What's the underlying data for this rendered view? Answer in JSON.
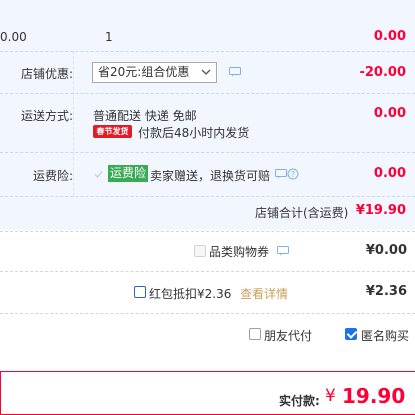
{
  "row_top": {
    "price": "0.00",
    "qty": "1",
    "subtotal": "0.00"
  },
  "shop_discount": {
    "label": "店铺优惠:",
    "select_value": "省20元:组合优惠",
    "amount": "-20.00"
  },
  "shipping": {
    "label": "运送方式:",
    "method": "普通配送 快递 免邮",
    "tag": "春节发货",
    "note": "付款后48小时内发货",
    "amount": "0.00"
  },
  "insurance": {
    "label": "运费险:",
    "tag": "运费险",
    "text": "卖家赠送，退换货可赔",
    "amount": "0.00"
  },
  "shop_total": {
    "label": "店铺合计(含运费)",
    "amount": "¥19.90"
  },
  "coupon": {
    "label": "品类购物券",
    "amount": "¥0.00"
  },
  "red_packet": {
    "label": "红包抵扣¥2.36",
    "link": "查看详情",
    "amount": "¥2.36"
  },
  "options": {
    "friend_pay": "朋友代付",
    "anonymous": "匿名购买",
    "anonymous_checked": true
  },
  "pay": {
    "label": "实付款:",
    "currency": "¥",
    "amount": "19.90"
  },
  "colors": {
    "accent_red": "#ff0036",
    "block_bg": "#f2f7ff",
    "link": "#c8a05a",
    "green_tag": "#3aab55",
    "red_tag": "#e21c24"
  }
}
